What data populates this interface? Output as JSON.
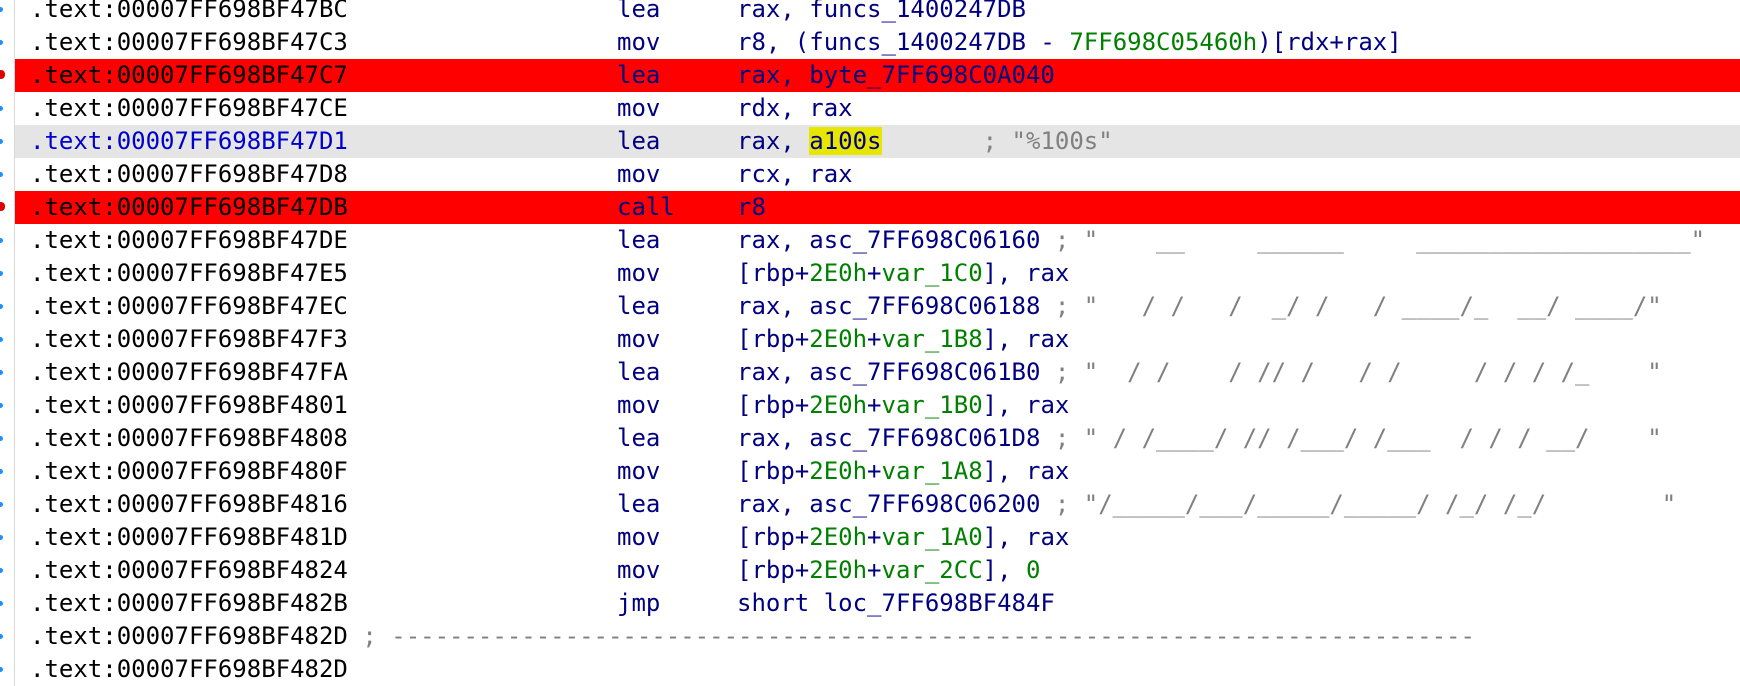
{
  "colors": {
    "breakpoint_row": "#ff0000",
    "current_row": "#e5e5e5",
    "register": "#000080",
    "number": "#008000",
    "comment": "#808080",
    "highlight": "#e6e600"
  },
  "rows": [
    {
      "addr": ".text:00007FF698BF47BC",
      "mnem": "lea",
      "ops": [
        {
          "t": "rax, ",
          "c": "reg"
        },
        {
          "t": "funcs_1400247DB",
          "c": "sym"
        }
      ],
      "kind": "plain",
      "gutter": "tick"
    },
    {
      "addr": ".text:00007FF698BF47C3",
      "mnem": "mov",
      "ops": [
        {
          "t": "r8, (funcs_1400247DB - ",
          "c": "reg"
        },
        {
          "t": "7FF698C05460h",
          "c": "num"
        },
        {
          "t": ")[rdx+rax]",
          "c": "reg"
        }
      ],
      "kind": "plain",
      "gutter": "tick"
    },
    {
      "addr": ".text:00007FF698BF47C7",
      "mnem": "lea",
      "ops": [
        {
          "t": "rax, byte_7FF698C0A040",
          "c": "reg"
        }
      ],
      "kind": "bp",
      "gutter": "bp"
    },
    {
      "addr": ".text:00007FF698BF47CE",
      "mnem": "mov",
      "ops": [
        {
          "t": "rdx, rax",
          "c": "reg"
        }
      ],
      "kind": "plain",
      "gutter": "tick"
    },
    {
      "addr": ".text:00007FF698BF47D1",
      "mnem": "lea",
      "ops": [
        {
          "t": "rax, ",
          "c": "reg"
        },
        {
          "t": "a100s",
          "c": "hl"
        },
        {
          "t": "       ; \"%100s\"",
          "c": "cmt"
        }
      ],
      "kind": "cur",
      "gutter": "tick"
    },
    {
      "addr": ".text:00007FF698BF47D8",
      "mnem": "mov",
      "ops": [
        {
          "t": "rcx, rax",
          "c": "reg"
        }
      ],
      "kind": "plain",
      "gutter": "tick"
    },
    {
      "addr": ".text:00007FF698BF47DB",
      "mnem": "call",
      "ops": [
        {
          "t": "r8",
          "c": "reg"
        }
      ],
      "kind": "bp",
      "gutter": "bp"
    },
    {
      "addr": ".text:00007FF698BF47DE",
      "mnem": "lea",
      "ops": [
        {
          "t": "rax, asc_7FF698C06160",
          "c": "reg"
        },
        {
          "t": " ; \"    __     ______     ___________________\"",
          "c": "cmt"
        }
      ],
      "kind": "plain",
      "gutter": "tick"
    },
    {
      "addr": ".text:00007FF698BF47E5",
      "mnem": "mov",
      "ops": [
        {
          "t": "[rbp+",
          "c": "reg"
        },
        {
          "t": "2E0h",
          "c": "num"
        },
        {
          "t": "+",
          "c": "reg"
        },
        {
          "t": "var_1C0",
          "c": "num"
        },
        {
          "t": "], rax",
          "c": "reg"
        }
      ],
      "kind": "plain",
      "gutter": "tick"
    },
    {
      "addr": ".text:00007FF698BF47EC",
      "mnem": "lea",
      "ops": [
        {
          "t": "rax, asc_7FF698C06188",
          "c": "reg"
        },
        {
          "t": " ; \"   / /   /  _/ /   / ____/_  __/ ____/\"",
          "c": "cmt"
        }
      ],
      "kind": "plain",
      "gutter": "tick"
    },
    {
      "addr": ".text:00007FF698BF47F3",
      "mnem": "mov",
      "ops": [
        {
          "t": "[rbp+",
          "c": "reg"
        },
        {
          "t": "2E0h",
          "c": "num"
        },
        {
          "t": "+",
          "c": "reg"
        },
        {
          "t": "var_1B8",
          "c": "num"
        },
        {
          "t": "], rax",
          "c": "reg"
        }
      ],
      "kind": "plain",
      "gutter": "tick"
    },
    {
      "addr": ".text:00007FF698BF47FA",
      "mnem": "lea",
      "ops": [
        {
          "t": "rax, asc_7FF698C061B0",
          "c": "reg"
        },
        {
          "t": " ; \"  / /    / // /   / /     / / / /_    \"",
          "c": "cmt"
        }
      ],
      "kind": "plain",
      "gutter": "tick"
    },
    {
      "addr": ".text:00007FF698BF4801",
      "mnem": "mov",
      "ops": [
        {
          "t": "[rbp+",
          "c": "reg"
        },
        {
          "t": "2E0h",
          "c": "num"
        },
        {
          "t": "+",
          "c": "reg"
        },
        {
          "t": "var_1B0",
          "c": "num"
        },
        {
          "t": "], rax",
          "c": "reg"
        }
      ],
      "kind": "plain",
      "gutter": "tick"
    },
    {
      "addr": ".text:00007FF698BF4808",
      "mnem": "lea",
      "ops": [
        {
          "t": "rax, asc_7FF698C061D8",
          "c": "reg"
        },
        {
          "t": " ; \" / /____/ // /___/ /___  / / / __/    \"",
          "c": "cmt"
        }
      ],
      "kind": "plain",
      "gutter": "tick"
    },
    {
      "addr": ".text:00007FF698BF480F",
      "mnem": "mov",
      "ops": [
        {
          "t": "[rbp+",
          "c": "reg"
        },
        {
          "t": "2E0h",
          "c": "num"
        },
        {
          "t": "+",
          "c": "reg"
        },
        {
          "t": "var_1A8",
          "c": "num"
        },
        {
          "t": "], rax",
          "c": "reg"
        }
      ],
      "kind": "plain",
      "gutter": "tick"
    },
    {
      "addr": ".text:00007FF698BF4816",
      "mnem": "lea",
      "ops": [
        {
          "t": "rax, asc_7FF698C06200",
          "c": "reg"
        },
        {
          "t": " ; \"/_____/___/_____/_____/ /_/ /_/        \"",
          "c": "cmt"
        }
      ],
      "kind": "plain",
      "gutter": "tick"
    },
    {
      "addr": ".text:00007FF698BF481D",
      "mnem": "mov",
      "ops": [
        {
          "t": "[rbp+",
          "c": "reg"
        },
        {
          "t": "2E0h",
          "c": "num"
        },
        {
          "t": "+",
          "c": "reg"
        },
        {
          "t": "var_1A0",
          "c": "num"
        },
        {
          "t": "], rax",
          "c": "reg"
        }
      ],
      "kind": "plain",
      "gutter": "tick"
    },
    {
      "addr": ".text:00007FF698BF4824",
      "mnem": "mov",
      "ops": [
        {
          "t": "[rbp+",
          "c": "reg"
        },
        {
          "t": "2E0h",
          "c": "num"
        },
        {
          "t": "+",
          "c": "reg"
        },
        {
          "t": "var_2CC",
          "c": "num"
        },
        {
          "t": "], ",
          "c": "reg"
        },
        {
          "t": "0",
          "c": "num"
        }
      ],
      "kind": "plain",
      "gutter": "tick"
    },
    {
      "addr": ".text:00007FF698BF482B",
      "mnem": "jmp",
      "ops": [
        {
          "t": "short loc_7FF698BF484F",
          "c": "reg"
        }
      ],
      "kind": "plain",
      "gutter": "tick"
    },
    {
      "addr": ".text:00007FF698BF482D",
      "mnem": "",
      "ops": [],
      "sep": " ; ---------------------------------------------------------------------------",
      "kind": "sep",
      "gutter": "tick"
    },
    {
      "addr": ".text:00007FF698BF482D",
      "mnem": "",
      "ops": [],
      "kind": "plain",
      "gutter": "tick"
    }
  ]
}
